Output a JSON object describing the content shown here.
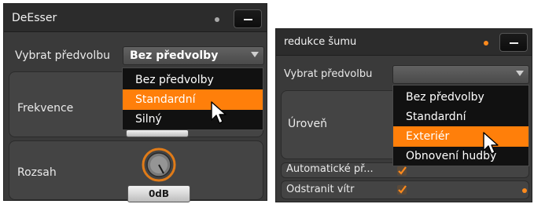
{
  "deesser": {
    "title": "DeEsser",
    "preset_label": "Vybrat předvolbu",
    "preset_value": "Bez předvolby",
    "menu_items": [
      "Bez předvolby",
      "Standardní",
      "Silný"
    ],
    "frequency_label": "Frekvence",
    "range_label": "Rozsah",
    "range_value": "0dB"
  },
  "noise_reduction": {
    "title": "redukce šumu",
    "preset_label": "Vybrat předvolbu",
    "preset_value": "",
    "menu_items": [
      "Bez předvolby",
      "Standardní",
      "Exteriér",
      "Obnovení hudby"
    ],
    "level_label": "Úroveň",
    "auto_label": "Automatické př...",
    "wind_label": "Odstranit vítr"
  },
  "colors": {
    "accent": "#ff7f0a",
    "panel_bg": "#3a3a3a",
    "menu_bg": "#111111"
  },
  "icons": {
    "minimize": "minus-icon",
    "dropdown": "chevron-down-icon",
    "cursor": "mouse-pointer-icon",
    "knob": "rotary-knob-icon",
    "check": "checkmark-icon"
  }
}
